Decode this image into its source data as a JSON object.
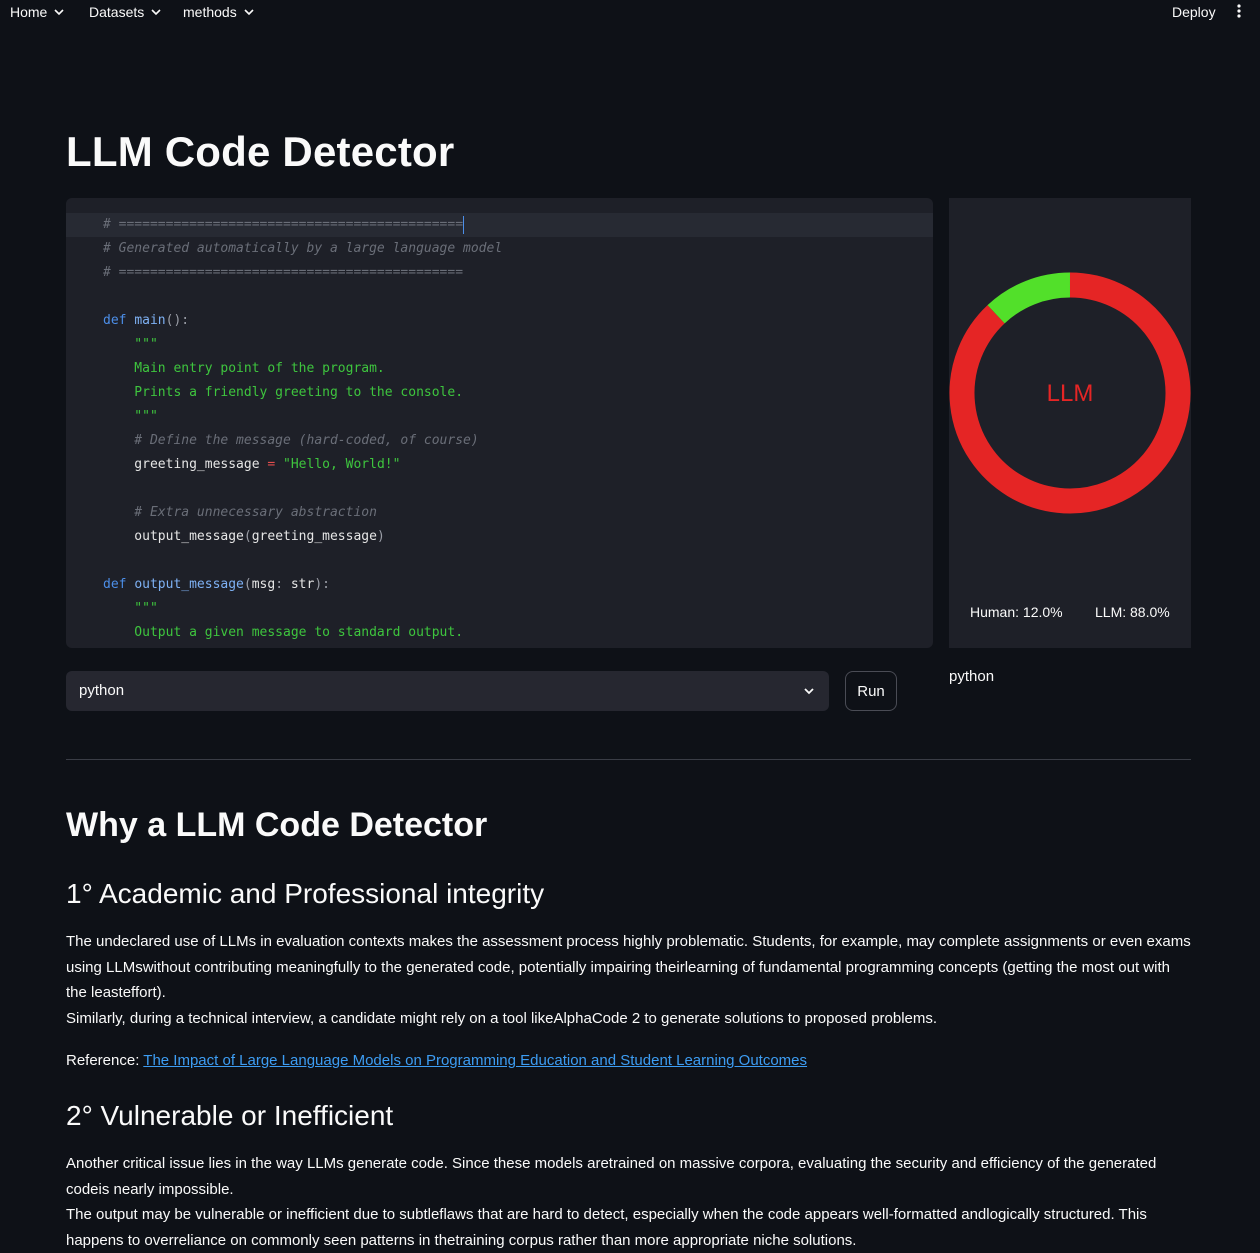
{
  "nav": {
    "items": [
      {
        "label": "Home"
      },
      {
        "label": "Datasets"
      },
      {
        "label": "methods"
      }
    ],
    "deploy_label": "Deploy",
    "menu_icon": "kebab-menu-icon"
  },
  "page": {
    "title": "LLM Code Detector"
  },
  "editor": {
    "lines": [
      [
        {
          "t": "# ============================================",
          "c": "com"
        }
      ],
      [
        {
          "t": "# Generated automatically by a large language model",
          "c": "com"
        }
      ],
      [
        {
          "t": "# ============================================",
          "c": "com"
        }
      ],
      [],
      [
        {
          "t": "def ",
          "c": "kw"
        },
        {
          "t": "main",
          "c": "fn"
        },
        {
          "t": "():",
          "c": "op"
        }
      ],
      [
        {
          "t": "    \"\"\"",
          "c": "str"
        }
      ],
      [
        {
          "t": "    Main entry point of the program.",
          "c": "str"
        }
      ],
      [
        {
          "t": "    Prints a friendly greeting to the console.",
          "c": "str"
        }
      ],
      [
        {
          "t": "    \"\"\"",
          "c": "str"
        }
      ],
      [
        {
          "t": "    # Define the message (hard-coded, of course)",
          "c": "com"
        }
      ],
      [
        {
          "t": "    greeting_message ",
          "c": "id"
        },
        {
          "t": "=",
          "c": "eq"
        },
        {
          "t": " \"Hello, World!\"",
          "c": "str"
        }
      ],
      [],
      [
        {
          "t": "    # Extra unnecessary abstraction",
          "c": "com"
        }
      ],
      [
        {
          "t": "    output_message",
          "c": "id"
        },
        {
          "t": "(",
          "c": "op"
        },
        {
          "t": "greeting_message",
          "c": "id"
        },
        {
          "t": ")",
          "c": "op"
        }
      ],
      [],
      [
        {
          "t": "def ",
          "c": "kw"
        },
        {
          "t": "output_message",
          "c": "fn"
        },
        {
          "t": "(",
          "c": "op"
        },
        {
          "t": "msg",
          "c": "id"
        },
        {
          "t": ": ",
          "c": "op"
        },
        {
          "t": "str",
          "c": "id"
        },
        {
          "t": "):",
          "c": "op"
        }
      ],
      [
        {
          "t": "    \"\"\"",
          "c": "str"
        }
      ],
      [
        {
          "t": "    Output a given message to standard output.",
          "c": "str"
        }
      ]
    ]
  },
  "result": {
    "verdict": "LLM",
    "human_pct": 12.0,
    "llm_pct": 88.0,
    "human_label": "Human: 12.0%",
    "llm_label": "LLM: 88.0%",
    "human_color": "#52e02a",
    "llm_color": "#e52525",
    "language": "python"
  },
  "controls": {
    "language_select_value": "python",
    "run_label": "Run"
  },
  "content": {
    "heading": "Why a LLM Code Detector",
    "section1": {
      "title": "1° Academic and Professional integrity",
      "para1": "The undeclared use of LLMs in evaluation contexts makes the assessment process highly problematic.  Students, for example, may complete assignments or even exams using LLMswithout contributing meaningfully to the generated code, potentially impairing theirlearning of fundamental programming concepts (getting the most out with the leasteffort).",
      "para2": "Similarly, during a technical interview, a candidate might rely on a tool likeAlphaCode 2 to generate solutions to proposed problems.",
      "ref_label": "Reference: ",
      "ref_link": "The Impact of Large Language Models on Programming Education and Student Learning Outcomes"
    },
    "section2": {
      "title": "2° Vulnerable or Inefficient",
      "para1": "Another critical issue lies in the way LLMs generate code. Since these models aretrained on massive corpora, evaluating the security and efficiency of the generated codeis nearly impossible.",
      "para2": "The output may be vulnerable or inefficient due to subtleflaws that are hard to detect, especially when the code appears well-formatted andlogically structured. This happens to overreliance on commonly seen patterns in thetraining corpus rather than more appropriate niche solutions."
    }
  }
}
